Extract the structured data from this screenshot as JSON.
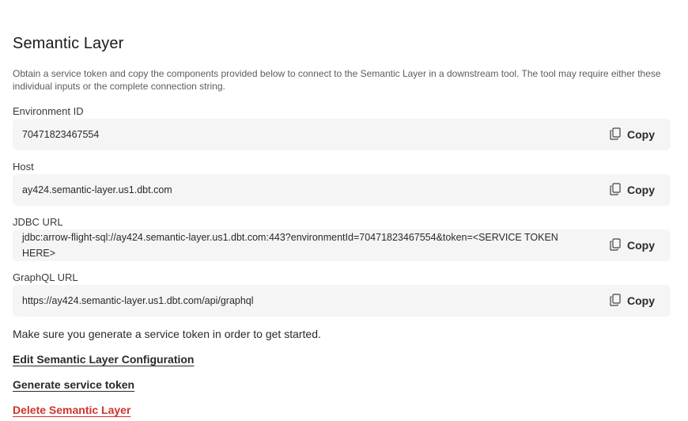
{
  "page": {
    "title": "Semantic Layer",
    "description": "Obtain a service token and copy the components provided below to connect to the Semantic Layer in a downstream tool. The tool may require either these individual inputs or the complete connection string."
  },
  "fields": [
    {
      "label": "Environment ID",
      "value": "70471823467554",
      "copy_label": "Copy"
    },
    {
      "label": "Host",
      "value": "ay424.semantic-layer.us1.dbt.com",
      "copy_label": "Copy"
    },
    {
      "label": "JDBC URL",
      "value": "jdbc:arrow-flight-sql://ay424.semantic-layer.us1.dbt.com:443?environmentId=70471823467554&token=<SERVICE TOKEN HERE>",
      "copy_label": "Copy"
    },
    {
      "label": "GraphQL URL",
      "value": "https://ay424.semantic-layer.us1.dbt.com/api/graphql",
      "copy_label": "Copy"
    }
  ],
  "note": "Make sure you generate a service token in order to get started.",
  "links": {
    "edit": "Edit Semantic Layer Configuration",
    "generate": "Generate service token",
    "delete": "Delete Semantic Layer"
  },
  "colors": {
    "danger": "#d0342c",
    "field_bg": "#f5f5f5"
  },
  "icons": {
    "copy": "copy-icon"
  }
}
